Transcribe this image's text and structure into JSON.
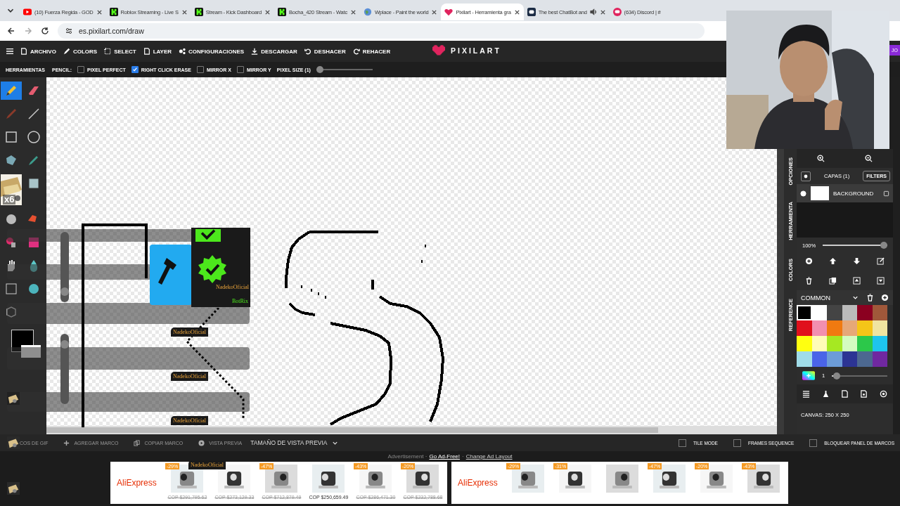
{
  "browser": {
    "tabs": [
      {
        "title": "(10) Fuerza Regida - GOD",
        "kind": "video",
        "audio": false,
        "selected": false
      },
      {
        "title": "Roblox Streaming - Live S",
        "kind": "kick",
        "audio": false,
        "selected": false
      },
      {
        "title": "Stream - Kick Dashboard",
        "kind": "kick",
        "audio": false,
        "selected": false
      },
      {
        "title": "Bocha_420 Stream - Watc",
        "kind": "kick",
        "audio": false,
        "selected": false
      },
      {
        "title": "Wplace - Paint the world",
        "kind": "globe",
        "audio": false,
        "selected": false
      },
      {
        "title": "Pixilart - Herramienta gra",
        "kind": "heart",
        "audio": false,
        "selected": true
      },
      {
        "title": "The best ChatBot and",
        "kind": "bot",
        "audio": true,
        "selected": false
      },
      {
        "title": "(634) Discord | #",
        "kind": "chat",
        "audio": false,
        "selected": false
      }
    ],
    "address": "es.pixilart.com/draw"
  },
  "toolbar": {
    "menu": [
      "ARCHIVO",
      "COLORS",
      "SELECT",
      "LAYER",
      "CONFIGURACIONES",
      "DESCARGAR",
      "DESHACER",
      "REHACER"
    ],
    "logo": "PIXILART",
    "account": "JO"
  },
  "options": {
    "panel": "HERRAMIENTAS",
    "tool": "PENCIL:",
    "checks": [
      {
        "label": "PIXEL PERFECT",
        "checked": false
      },
      {
        "label": "RIGHT CLICK ERASE",
        "checked": true
      },
      {
        "label": "MIRROR X",
        "checked": false
      },
      {
        "label": "MIRROR Y",
        "checked": false
      }
    ],
    "pixel_size": {
      "label": "PIXEL SIZE (1)",
      "level": 0
    }
  },
  "tools": [
    {
      "selected": true
    },
    {
      "selected": false
    },
    {
      "selected": false
    },
    {
      "selected": false
    },
    {
      "selected": false
    },
    {
      "selected": false
    },
    {
      "selected": false
    },
    {
      "selected": false
    },
    {
      "selected": false
    },
    {
      "selected": false
    },
    {
      "selected": false
    },
    {
      "selected": false
    },
    {
      "selected": false
    },
    {
      "selected": false
    },
    {
      "selected": false
    },
    {
      "selected": false
    },
    {
      "selected": false
    },
    {
      "selected": false
    }
  ],
  "stream_overlay": {
    "multiplier": "x6",
    "sliders": [
      {
        "level": 0.1
      },
      {
        "level": 0.9
      }
    ],
    "card": {
      "name": "NadekoOficial",
      "bot": "BotRix"
    },
    "tags": [
      "NadekoOficial",
      "NadekoOficial",
      "NadekoOficial",
      "NadekoOficial"
    ]
  },
  "side_panel": {
    "tabs": [
      "OPCIONES",
      "HERRAMIENTA",
      "COLORS",
      "REFERENCE"
    ],
    "layers": {
      "title": "CAPAS (1)",
      "filters": "FILTERS",
      "items": [
        {
          "name": "BACKGROUND",
          "visible": true,
          "selected": true
        }
      ]
    },
    "opacity": {
      "reading": "100%",
      "level": 1
    },
    "palette": {
      "name": "COMMON",
      "colors": [
        {
          "color": "#000000",
          "selected": true
        },
        {
          "color": "#ffffff",
          "selected": false
        },
        {
          "color": "#444444",
          "selected": false
        },
        {
          "color": "#bbbbbb",
          "selected": false
        },
        {
          "color": "#8b0020",
          "selected": false
        },
        {
          "color": "#a0583a",
          "selected": false
        },
        {
          "color": "#e0101c",
          "selected": false
        },
        {
          "color": "#f28fb0",
          "selected": false
        },
        {
          "color": "#f07a10",
          "selected": false
        },
        {
          "color": "#e6a878",
          "selected": false
        },
        {
          "color": "#f5c518",
          "selected": false
        },
        {
          "color": "#f0e4a0",
          "selected": false
        },
        {
          "color": "#ffff10",
          "selected": false
        },
        {
          "color": "#fffcb8",
          "selected": false
        },
        {
          "color": "#a6e822",
          "selected": false
        },
        {
          "color": "#d4fcc0",
          "selected": false
        },
        {
          "color": "#2cc84a",
          "selected": false
        },
        {
          "color": "#1ec4ee",
          "selected": false
        },
        {
          "color": "#a0dce8",
          "selected": false
        },
        {
          "color": "#4a64e8",
          "selected": false
        },
        {
          "color": "#6c9cd8",
          "selected": false
        },
        {
          "color": "#2c3494",
          "selected": false
        },
        {
          "color": "#4c6890",
          "selected": false
        },
        {
          "color": "#7028a0",
          "selected": false
        }
      ]
    },
    "brush": {
      "reading": "1",
      "level": 0.03
    },
    "canvas_size": "CANVAS: 250 X 250"
  },
  "frames_bar": {
    "actions": [
      "COS DE GIF",
      "AGREGAR MARCO",
      "COPIAR MARCO",
      "VISTA PREVIA"
    ],
    "preview_size": "TAMAÑO DE VISTA PREVIA",
    "checks": [
      {
        "label": "TILE MODE",
        "checked": false
      },
      {
        "label": "FRAMES SEQUENCE",
        "checked": false
      },
      {
        "label": "BLOQUEAR PANEL DE MARCOS",
        "checked": false
      }
    ]
  },
  "ad": {
    "label": "Advertisement ·",
    "links": [
      "Go Ad-Free!",
      "Change Ad Layout"
    ],
    "separator": "·",
    "banners": [
      {
        "brand": "AliExpress",
        "products": [
          {
            "kind": "picture",
            "discount": "-29%",
            "price": "COP $291,795.62"
          },
          {
            "kind": "picture",
            "price": "COP $273,129.33"
          },
          {
            "kind": "picture",
            "discount": "-47%",
            "price": "COP $712,879.49"
          },
          {
            "kind": "picture",
            "price": "COP $250,659.49",
            "current": true
          },
          {
            "kind": "picture",
            "discount": "-43%",
            "price": "COP $286,471.30"
          },
          {
            "kind": "picture",
            "discount": "-20%",
            "price": "COP $232,788.68"
          }
        ]
      },
      {
        "brand": "AliExpress",
        "products": [
          {
            "kind": "picture",
            "discount": "-29%"
          },
          {
            "kind": "picture",
            "discount": "-31%"
          },
          {
            "kind": "picture"
          },
          {
            "kind": "picture",
            "discount": "-47%"
          },
          {
            "kind": "picture",
            "discount": "-20%"
          },
          {
            "kind": "picture",
            "discount": "-43%"
          }
        ]
      }
    ]
  }
}
